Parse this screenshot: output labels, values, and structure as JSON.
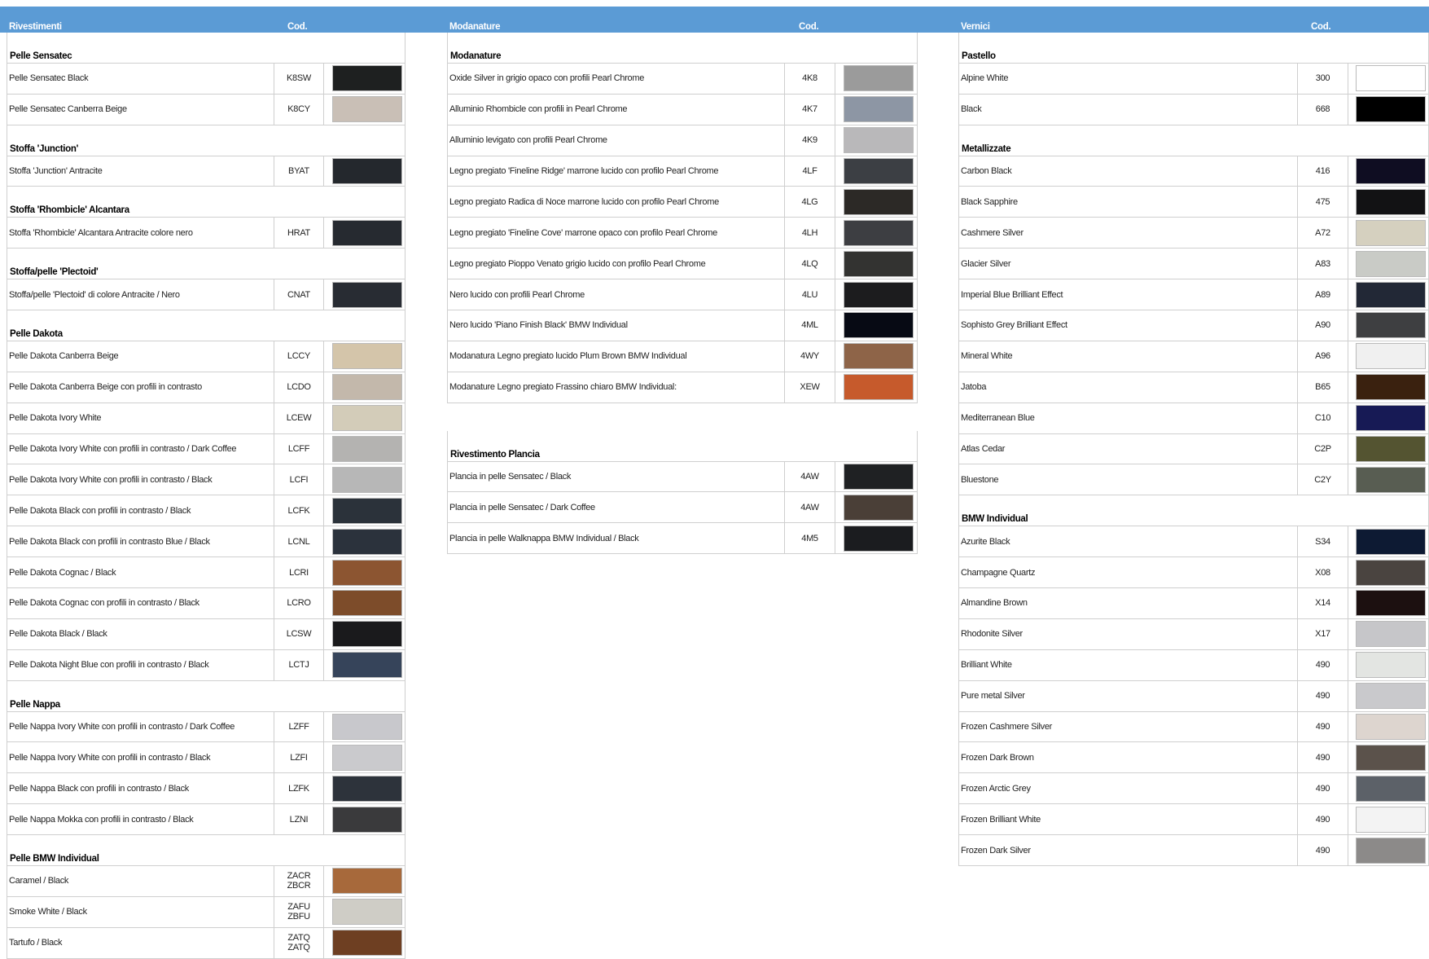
{
  "columns": {
    "left": {
      "header": {
        "title": "Rivestimenti",
        "code": "Cod."
      },
      "groups": [
        {
          "title": "Pelle Sensatec",
          "rows": [
            {
              "name": "Pelle Sensatec Black",
              "code": "K8SW",
              "color": "#1e2020"
            },
            {
              "name": "Pelle Sensatec Canberra Beige",
              "code": "K8CY",
              "color": "#c9bfb6"
            }
          ]
        },
        {
          "title": "Stoffa 'Junction'",
          "rows": [
            {
              "name": "Stoffa 'Junction' Antracite",
              "code": "BYAT",
              "color": "#24282d"
            }
          ]
        },
        {
          "title": "Stoffa 'Rhombicle' Alcantara",
          "rows": [
            {
              "name": "Stoffa 'Rhombicle' Alcantara Antracite colore nero",
              "code": "HRAT",
              "color": "#262a30"
            }
          ]
        },
        {
          "title": "Stoffa/pelle 'Plectoid'",
          "rows": [
            {
              "name": "Stoffa/pelle 'Plectoid' di colore Antracite / Nero",
              "code": "CNAT",
              "color": "#282c33"
            }
          ]
        },
        {
          "title": "Pelle Dakota",
          "rows": [
            {
              "name": "Pelle Dakota Canberra Beige",
              "code": "LCCY",
              "color": "#d4c5aa"
            },
            {
              "name": "Pelle Dakota Canberra Beige con profili in contrasto",
              "code": "LCDO",
              "color": "#c3b8ab"
            },
            {
              "name": "Pelle Dakota Ivory White",
              "code": "LCEW",
              "color": "#d3ccb9"
            },
            {
              "name": "Pelle Dakota Ivory White con profili in contrasto / Dark Coffee",
              "code": "LCFF",
              "color": "#b4b3b1"
            },
            {
              "name": "Pelle Dakota Ivory White con profili in contrasto / Black",
              "code": "LCFI",
              "color": "#b7b7b7"
            },
            {
              "name": "Pelle Dakota Black con profili in contrasto / Black",
              "code": "LCFK",
              "color": "#2b323a"
            },
            {
              "name": "Pelle Dakota Black con profili in contrasto Blue / Black",
              "code": "LCNL",
              "color": "#2b323c"
            },
            {
              "name": "Pelle Dakota Cognac / Black",
              "code": "LCRI",
              "color": "#8c5531"
            },
            {
              "name": "Pelle Dakota Cognac con profili in contrasto / Black",
              "code": "LCRO",
              "color": "#7d4c2a"
            },
            {
              "name": "Pelle Dakota Black / Black",
              "code": "LCSW",
              "color": "#1a1a1c"
            },
            {
              "name": "Pelle Dakota Night Blue con profili in contrasto / Black",
              "code": "LCTJ",
              "color": "#36445a"
            }
          ]
        },
        {
          "title": "Pelle Nappa",
          "rows": [
            {
              "name": "Pelle Nappa Ivory White con profili in contrasto / Dark Coffee",
              "code": "LZFF",
              "color": "#c8c8cc"
            },
            {
              "name": "Pelle Nappa Ivory White con profili in contrasto / Black",
              "code": "LZFI",
              "color": "#cacacd"
            },
            {
              "name": "Pelle Nappa Black con profili in contrasto / Black",
              "code": "LZFK",
              "color": "#2d333b"
            },
            {
              "name": "Pelle Nappa Mokka con profili in contrasto / Black",
              "code": "LZNI",
              "color": "#3a3a3c"
            }
          ]
        },
        {
          "title": "Pelle BMW Individual",
          "rows": [
            {
              "name": "Caramel / Black",
              "code": "ZACR\nZBCR",
              "color": "#a7693b"
            },
            {
              "name": "Smoke White / Black",
              "code": "ZAFU\nZBFU",
              "color": "#cfcdc6"
            },
            {
              "name": "Tartufo / Black",
              "code": "ZATQ\nZATQ",
              "color": "#6e3f22"
            }
          ]
        }
      ]
    },
    "middle": {
      "header": {
        "title": "Modanature",
        "code": "Cod."
      },
      "groups": [
        {
          "title": "Modanature",
          "rows": [
            {
              "name": "Oxide Silver in grigio opaco con profili Pearl Chrome",
              "code": "4K8",
              "color": "#9b9b9b"
            },
            {
              "name": "Alluminio Rhombicle con profili in Pearl Chrome",
              "code": "4K7",
              "color": "#8d96a4"
            },
            {
              "name": "Alluminio levigato con profili Pearl Chrome",
              "code": "4K9",
              "color": "#b9b8ba"
            },
            {
              "name": "Legno pregiato 'Fineline Ridge' marrone lucido con profilo Pearl Chrome",
              "code": "4LF",
              "color": "#3c3f44"
            },
            {
              "name": "Legno pregiato Radica di Noce marrone lucido con profilo Pearl Chrome",
              "code": "4LG",
              "color": "#2c2926"
            },
            {
              "name": "Legno pregiato 'Fineline Cove' marrone opaco con profilo Pearl Chrome",
              "code": "4LH",
              "color": "#3d3e42"
            },
            {
              "name": "Legno pregiato Pioppo Venato grigio lucido con profilo Pearl Chrome",
              "code": "4LQ",
              "color": "#333331"
            },
            {
              "name": "Nero lucido con profili Pearl Chrome",
              "code": "4LU",
              "color": "#1c1c1e"
            },
            {
              "name": "Nero lucido 'Piano Finish Black' BMW Individual",
              "code": "4ML",
              "color": "#070a14"
            },
            {
              "name": "Modanatura Legno pregiato lucido Plum Brown BMW Individual",
              "code": "4WY",
              "color": "#8e6448"
            },
            {
              "name": "Modanature Legno pregiato Frassino chiaro BMW Individual:",
              "code": "XEW",
              "color": "#c65a2c"
            }
          ]
        },
        {
          "title": "Rivestimento Plancia",
          "rows": [
            {
              "name": "Plancia in pelle Sensatec / Black",
              "code": "4AW",
              "color": "#1f2123"
            },
            {
              "name": "Plancia in pelle Sensatec / Dark Coffee",
              "code": "4AW",
              "color": "#4a3f37"
            },
            {
              "name": "Plancia in pelle Walknappa BMW Individual / Black",
              "code": "4M5",
              "color": "#1b1c1f"
            }
          ]
        }
      ]
    },
    "right": {
      "header": {
        "title": "Vernici",
        "code": "Cod."
      },
      "groups": [
        {
          "title": "Pastello",
          "rows": [
            {
              "name": "Alpine White",
              "code": "300",
              "color": "#ffffff"
            },
            {
              "name": "Black",
              "code": "668",
              "color": "#000000"
            }
          ]
        },
        {
          "title": "Metallizzate",
          "rows": [
            {
              "name": "Carbon Black",
              "code": "416",
              "color": "#0f0d22"
            },
            {
              "name": "Black Sapphire",
              "code": "475",
              "color": "#121214"
            },
            {
              "name": "Cashmere Silver",
              "code": "A72",
              "color": "#d5d0bf"
            },
            {
              "name": "Glacier Silver",
              "code": "A83",
              "color": "#c9cbc6"
            },
            {
              "name": "Imperial Blue Brilliant Effect",
              "code": "A89",
              "color": "#222836"
            },
            {
              "name": "Sophisto Grey Brilliant Effect",
              "code": "A90",
              "color": "#3e3f41"
            },
            {
              "name": "Mineral White",
              "code": "A96",
              "color": "#f0f0f0"
            },
            {
              "name": "Jatoba",
              "code": "B65",
              "color": "#3a210f"
            },
            {
              "name": "Mediterranean Blue",
              "code": "C10",
              "color": "#171a55"
            },
            {
              "name": "Atlas Cedar",
              "code": "C2P",
              "color": "#545431"
            },
            {
              "name": "Bluestone",
              "code": "C2Y",
              "color": "#585d52"
            }
          ]
        },
        {
          "title": "BMW Individual",
          "rows": [
            {
              "name": "Azurite Black",
              "code": "S34",
              "color": "#0d1a33"
            },
            {
              "name": "Champagne Quartz",
              "code": "X08",
              "color": "#4a4440"
            },
            {
              "name": "Almandine Brown",
              "code": "X14",
              "color": "#1c1010"
            },
            {
              "name": "Rhodonite Silver",
              "code": "X17",
              "color": "#c6c6c9"
            },
            {
              "name": "Brilliant White",
              "code": "490",
              "color": "#e3e5e2"
            },
            {
              "name": "Pure metal Silver",
              "code": "490",
              "color": "#c9c9cc"
            },
            {
              "name": "Frozen Cashmere Silver",
              "code": "490",
              "color": "#ddd5cf"
            },
            {
              "name": "Frozen Dark Brown",
              "code": "490",
              "color": "#5b524b"
            },
            {
              "name": "Frozen Arctic Grey",
              "code": "490",
              "color": "#5c6168"
            },
            {
              "name": "Frozen Brilliant White",
              "code": "490",
              "color": "#f3f3f3"
            },
            {
              "name": "Frozen Dark Silver",
              "code": "490",
              "color": "#8c8a89"
            }
          ]
        }
      ]
    }
  }
}
